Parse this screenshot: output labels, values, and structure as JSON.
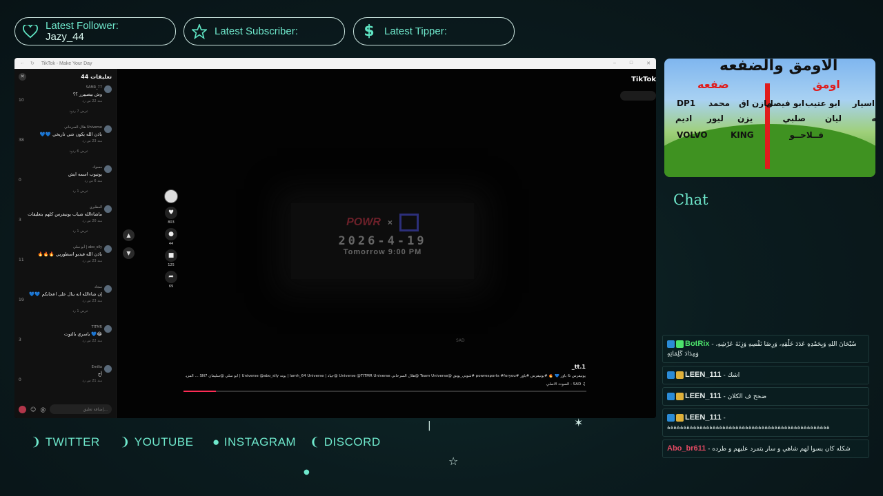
{
  "alerts": [
    {
      "label": "Latest Follower:",
      "value": "Jazy_44",
      "icon": "heart-icon"
    },
    {
      "label": "Latest Subscriber:",
      "value": "",
      "icon": "star-icon"
    },
    {
      "label": "Latest Tipper:",
      "value": "",
      "icon": "dollar-icon"
    }
  ],
  "window": {
    "title": "TikTok - Make Your Day",
    "comments_header": "تعليقات 44",
    "comments": [
      {
        "user": "SAMR_77",
        "text": "وش بيصييرر ؟؟",
        "likes": "10",
        "meta": "منذ 22 س  رد",
        "replies": "عرض 7 ردود"
      },
      {
        "user": "هلال السرحاني Universe",
        "text": "باذن الله يكون شي تاريخي 💙💙",
        "likes": "38",
        "meta": "منذ 23 س  رد",
        "replies": "عرض 6 ردود"
      },
      {
        "user": "مسوك",
        "text": "يوتيوب اسمه ايش",
        "likes": "0",
        "meta": "منذ 6 س  رد",
        "replies": "عرض 1 رد"
      },
      {
        "user": "المطيري",
        "text": "ماشاءالله شباب يونيفرس كلهم بتعليقات",
        "likes": "3",
        "meta": "منذ 20 س  رد",
        "replies": "عرض 1 رد"
      },
      {
        "user": "أبو سلي | abo_sily",
        "text": "باذن الله فيديو اسطوريي 🔥🔥🔥",
        "likes": "11",
        "meta": "منذ 23 س  رد",
        "replies": ""
      },
      {
        "user": "سجاد",
        "text": "إن شاءالله انه ينال على اعجابكم 💙💙",
        "likes": "19",
        "meta": "منذ 23 س  رد",
        "replies": "عرض 1 رد"
      },
      {
        "user": "TITMR",
        "text": "😂💙 ياسري بالتوت",
        "likes": "3",
        "meta": "منذ 22 س  رد",
        "replies": ""
      },
      {
        "user": "Emilia",
        "text": "أح",
        "likes": "0",
        "meta": "منذ 21 س  رد",
        "replies": ""
      }
    ],
    "comment_placeholder": "إضافة تعليق...",
    "actions": {
      "likes": "803",
      "comments": "44",
      "saves": "125",
      "shares": "69"
    },
    "promo": {
      "brand_left": "POWR",
      "brand_sep": "×",
      "date": "2026-4-19",
      "time": "Tomorrow 9:00 PM"
    },
    "sad_label": "SAD",
    "video_author": "tt.1_",
    "video_caption": "يونيفرس & باور 💙 🔥 #يونيفرس #باور #powresports #foryou #شوتي_يونق @Team Universe @هلال السرحاني Universe @TITMR Universe @جياد | lamh_64 Universe | يونه Universe @abo_sily | أبو سلي @سليمان SN7 ... المزيد",
    "video_sound": "♫ SAD - الصوت الأصلي",
    "video_progress": 0.08,
    "tiktok_logo": "TikTok"
  },
  "brand_panel": {
    "title": "الاومق والضفعه",
    "left_head": "اومق",
    "right_head": "ضفعه",
    "left_names": [
      "اسيار",
      "ابو عتيب",
      "ابو فيصل",
      "ليه",
      "ليان",
      "صلبي",
      "فــلاحــو"
    ],
    "right_names": [
      "مازن اق",
      "محمد",
      "DP1",
      "يزن",
      "ليور",
      "اديم",
      "VOLVO",
      "KING"
    ]
  },
  "chat": {
    "title": "Chat",
    "messages": [
      {
        "name": "BotRix",
        "name_color": "#4ce36b",
        "text": "سُبْحَانَ اللهِ وَبِحَمْدِهِ عَدَدَ خَلْقِهِ، وَرِضَا نَفْسِهِ وَزِنَةَ عَرْشِهِ، وَمِدَادَ كَلِمَاتِهِ"
      },
      {
        "name": "LEEN_111",
        "name_color": "#e9f0ee",
        "text": "اشك"
      },
      {
        "name": "LEEN_111",
        "name_color": "#e9f0ee",
        "text": "ضحح ف الكلان"
      },
      {
        "name": "LEEN_111",
        "name_color": "#e9f0ee",
        "text": "ةةةةةةةةةةةةةةةةةةةةةةةةةةةةةةةةةةةةةةةةةةةةةةةةةة"
      },
      {
        "name": "Abo_br611",
        "name_color": "#e24a63",
        "text": "شكله كان يسوا لهم شاهي و سار يتمرد عليهم و طرده"
      }
    ]
  },
  "socials": [
    {
      "label": "TWITTER",
      "icon": "half-moon-icon"
    },
    {
      "label": "YOUTUBE",
      "icon": "half-moon-icon"
    },
    {
      "label": "INSTAGRAM",
      "icon": "circle-icon"
    },
    {
      "label": "DISCORD",
      "icon": "crescent-icon"
    }
  ],
  "colors": {
    "accent": "#6fe8cc",
    "background": "#0b1c1f",
    "tiktok_red": "#fe2c55"
  }
}
